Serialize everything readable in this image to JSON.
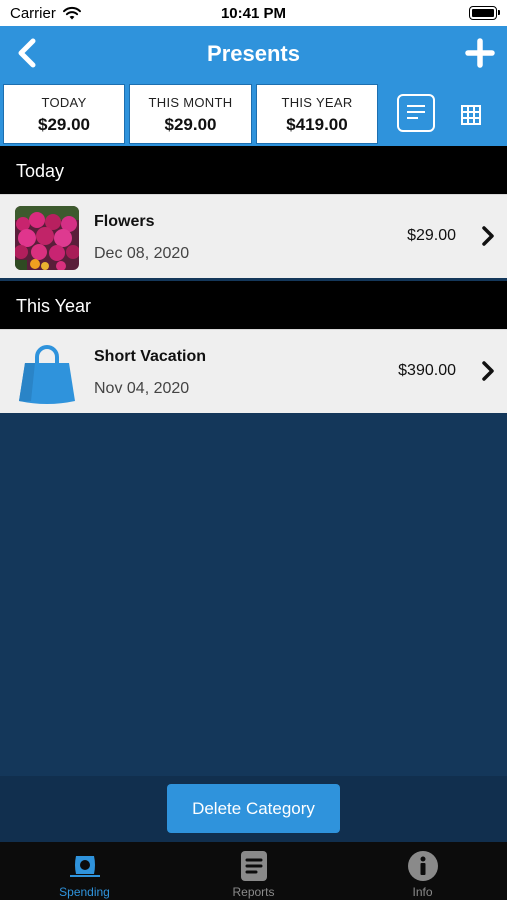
{
  "status_bar": {
    "carrier": "Carrier",
    "time": "10:41 PM"
  },
  "navbar": {
    "title": "Presents",
    "back_icon": "chevron-left-icon",
    "add_icon": "plus-icon"
  },
  "summary": [
    {
      "label": "TODAY",
      "value": "$29.00"
    },
    {
      "label": "THIS MONTH",
      "value": "$29.00"
    },
    {
      "label": "THIS YEAR",
      "value": "$419.00"
    }
  ],
  "view_toggles": {
    "list_icon": "list-view-icon",
    "grid_icon": "grid-view-icon"
  },
  "sections": [
    {
      "header": "Today",
      "items": [
        {
          "title": "Flowers",
          "date": "Dec 08, 2020",
          "amount": "$29.00",
          "thumbnail": "flowers-photo"
        }
      ]
    },
    {
      "header": "This Year",
      "items": [
        {
          "title": "Short Vacation",
          "date": "Nov 04, 2020",
          "amount": "$390.00",
          "thumbnail": "shopping-bag-icon"
        }
      ]
    }
  ],
  "footer": {
    "delete_label": "Delete Category"
  },
  "tabbar": {
    "tabs": [
      {
        "label": "Spending",
        "icon": "money-icon",
        "active": true
      },
      {
        "label": "Reports",
        "icon": "reports-icon",
        "active": false
      },
      {
        "label": "Info",
        "icon": "info-icon",
        "active": false
      }
    ]
  },
  "colors": {
    "accent": "#2f93dc",
    "background": "#14375a",
    "section_header": "#000000",
    "tabbar": "#0c0c0c"
  }
}
